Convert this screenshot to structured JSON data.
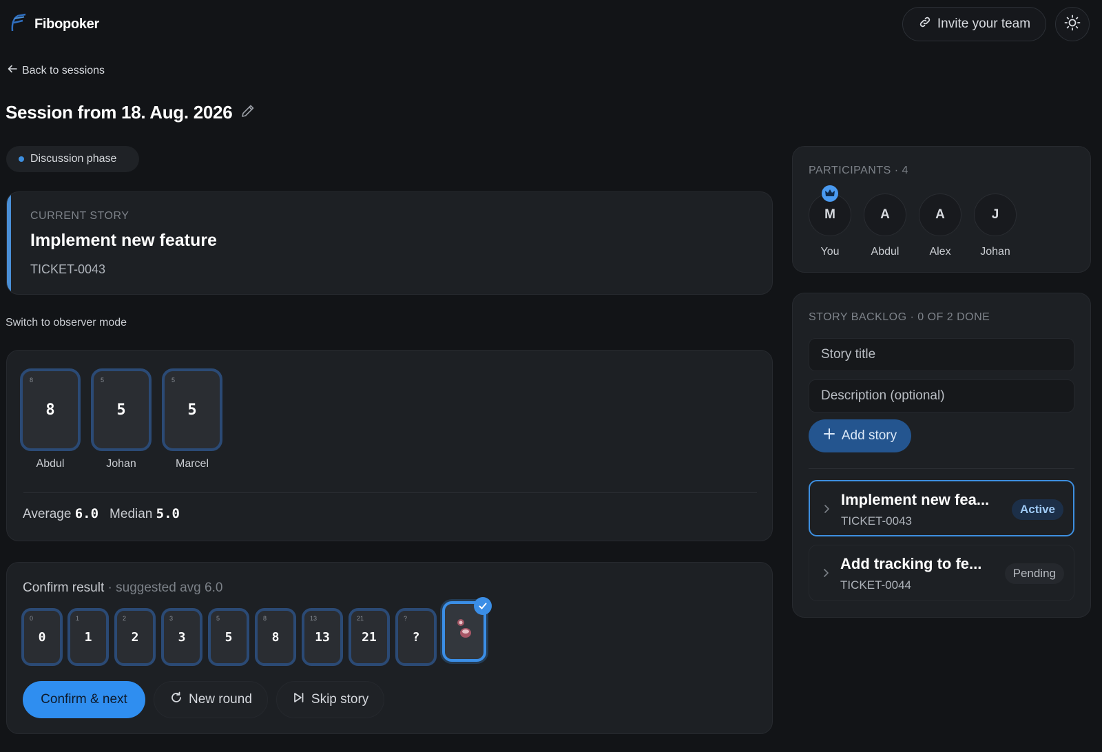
{
  "header": {
    "brand": "Fibopoker",
    "invite_label": "Invite your team"
  },
  "nav": {
    "back_label": "Back to sessions"
  },
  "session": {
    "title": "Session from 18. Aug. 2026"
  },
  "phase": {
    "label": "Discussion phase"
  },
  "current_story": {
    "label": "CURRENT STORY",
    "title": "Implement new feature",
    "ticket": "TICKET-0043"
  },
  "observer_label": "Switch to observer mode",
  "votes": [
    {
      "value": "8",
      "name": "Abdul"
    },
    {
      "value": "5",
      "name": "Johan"
    },
    {
      "value": "5",
      "name": "Marcel"
    }
  ],
  "stats": {
    "average_label": "Average",
    "average_value": "6.0",
    "median_label": "Median",
    "median_value": "5.0"
  },
  "confirm": {
    "label": "Confirm result",
    "hint": " · suggested avg 6.0",
    "cards": [
      "0",
      "1",
      "2",
      "3",
      "5",
      "8",
      "13",
      "21",
      "?"
    ],
    "selected_card": "coffee",
    "confirm_label": "Confirm & next",
    "new_round_label": "New round",
    "skip_label": "Skip story"
  },
  "participants": {
    "label": "PARTICIPANTS · 4",
    "people": [
      {
        "initial": "M",
        "name": "You",
        "host": true
      },
      {
        "initial": "A",
        "name": "Abdul"
      },
      {
        "initial": "A",
        "name": "Alex"
      },
      {
        "initial": "J",
        "name": "Johan"
      }
    ]
  },
  "backlog": {
    "label": "STORY BACKLOG · 0 OF 2 DONE",
    "title_placeholder": "Story title",
    "desc_placeholder": "Description (optional)",
    "add_label": "Add story",
    "stories": [
      {
        "title": "Implement new fea...",
        "ticket": "TICKET-0043",
        "status": "Active"
      },
      {
        "title": "Add tracking to fe...",
        "ticket": "TICKET-0044",
        "status": "Pending"
      }
    ]
  },
  "colors": {
    "accent": "#3d8fe0",
    "background": "#121417",
    "card": "#1d2024"
  }
}
